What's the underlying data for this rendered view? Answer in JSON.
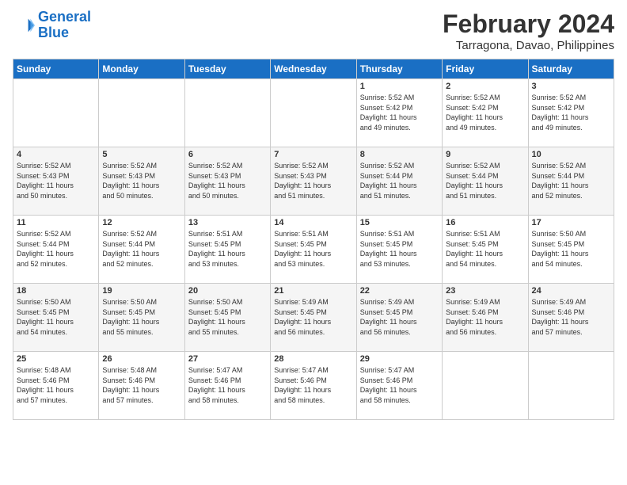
{
  "logo": {
    "line1": "General",
    "line2": "Blue"
  },
  "title": "February 2024",
  "subtitle": "Tarragona, Davao, Philippines",
  "days_header": [
    "Sunday",
    "Monday",
    "Tuesday",
    "Wednesday",
    "Thursday",
    "Friday",
    "Saturday"
  ],
  "weeks": [
    [
      {
        "day": "",
        "info": ""
      },
      {
        "day": "",
        "info": ""
      },
      {
        "day": "",
        "info": ""
      },
      {
        "day": "",
        "info": ""
      },
      {
        "day": "1",
        "info": "Sunrise: 5:52 AM\nSunset: 5:42 PM\nDaylight: 11 hours\nand 49 minutes."
      },
      {
        "day": "2",
        "info": "Sunrise: 5:52 AM\nSunset: 5:42 PM\nDaylight: 11 hours\nand 49 minutes."
      },
      {
        "day": "3",
        "info": "Sunrise: 5:52 AM\nSunset: 5:42 PM\nDaylight: 11 hours\nand 49 minutes."
      }
    ],
    [
      {
        "day": "4",
        "info": "Sunrise: 5:52 AM\nSunset: 5:43 PM\nDaylight: 11 hours\nand 50 minutes."
      },
      {
        "day": "5",
        "info": "Sunrise: 5:52 AM\nSunset: 5:43 PM\nDaylight: 11 hours\nand 50 minutes."
      },
      {
        "day": "6",
        "info": "Sunrise: 5:52 AM\nSunset: 5:43 PM\nDaylight: 11 hours\nand 50 minutes."
      },
      {
        "day": "7",
        "info": "Sunrise: 5:52 AM\nSunset: 5:43 PM\nDaylight: 11 hours\nand 51 minutes."
      },
      {
        "day": "8",
        "info": "Sunrise: 5:52 AM\nSunset: 5:44 PM\nDaylight: 11 hours\nand 51 minutes."
      },
      {
        "day": "9",
        "info": "Sunrise: 5:52 AM\nSunset: 5:44 PM\nDaylight: 11 hours\nand 51 minutes."
      },
      {
        "day": "10",
        "info": "Sunrise: 5:52 AM\nSunset: 5:44 PM\nDaylight: 11 hours\nand 52 minutes."
      }
    ],
    [
      {
        "day": "11",
        "info": "Sunrise: 5:52 AM\nSunset: 5:44 PM\nDaylight: 11 hours\nand 52 minutes."
      },
      {
        "day": "12",
        "info": "Sunrise: 5:52 AM\nSunset: 5:44 PM\nDaylight: 11 hours\nand 52 minutes."
      },
      {
        "day": "13",
        "info": "Sunrise: 5:51 AM\nSunset: 5:45 PM\nDaylight: 11 hours\nand 53 minutes."
      },
      {
        "day": "14",
        "info": "Sunrise: 5:51 AM\nSunset: 5:45 PM\nDaylight: 11 hours\nand 53 minutes."
      },
      {
        "day": "15",
        "info": "Sunrise: 5:51 AM\nSunset: 5:45 PM\nDaylight: 11 hours\nand 53 minutes."
      },
      {
        "day": "16",
        "info": "Sunrise: 5:51 AM\nSunset: 5:45 PM\nDaylight: 11 hours\nand 54 minutes."
      },
      {
        "day": "17",
        "info": "Sunrise: 5:50 AM\nSunset: 5:45 PM\nDaylight: 11 hours\nand 54 minutes."
      }
    ],
    [
      {
        "day": "18",
        "info": "Sunrise: 5:50 AM\nSunset: 5:45 PM\nDaylight: 11 hours\nand 54 minutes."
      },
      {
        "day": "19",
        "info": "Sunrise: 5:50 AM\nSunset: 5:45 PM\nDaylight: 11 hours\nand 55 minutes."
      },
      {
        "day": "20",
        "info": "Sunrise: 5:50 AM\nSunset: 5:45 PM\nDaylight: 11 hours\nand 55 minutes."
      },
      {
        "day": "21",
        "info": "Sunrise: 5:49 AM\nSunset: 5:45 PM\nDaylight: 11 hours\nand 56 minutes."
      },
      {
        "day": "22",
        "info": "Sunrise: 5:49 AM\nSunset: 5:45 PM\nDaylight: 11 hours\nand 56 minutes."
      },
      {
        "day": "23",
        "info": "Sunrise: 5:49 AM\nSunset: 5:46 PM\nDaylight: 11 hours\nand 56 minutes."
      },
      {
        "day": "24",
        "info": "Sunrise: 5:49 AM\nSunset: 5:46 PM\nDaylight: 11 hours\nand 57 minutes."
      }
    ],
    [
      {
        "day": "25",
        "info": "Sunrise: 5:48 AM\nSunset: 5:46 PM\nDaylight: 11 hours\nand 57 minutes."
      },
      {
        "day": "26",
        "info": "Sunrise: 5:48 AM\nSunset: 5:46 PM\nDaylight: 11 hours\nand 57 minutes."
      },
      {
        "day": "27",
        "info": "Sunrise: 5:47 AM\nSunset: 5:46 PM\nDaylight: 11 hours\nand 58 minutes."
      },
      {
        "day": "28",
        "info": "Sunrise: 5:47 AM\nSunset: 5:46 PM\nDaylight: 11 hours\nand 58 minutes."
      },
      {
        "day": "29",
        "info": "Sunrise: 5:47 AM\nSunset: 5:46 PM\nDaylight: 11 hours\nand 58 minutes."
      },
      {
        "day": "",
        "info": ""
      },
      {
        "day": "",
        "info": ""
      }
    ]
  ]
}
